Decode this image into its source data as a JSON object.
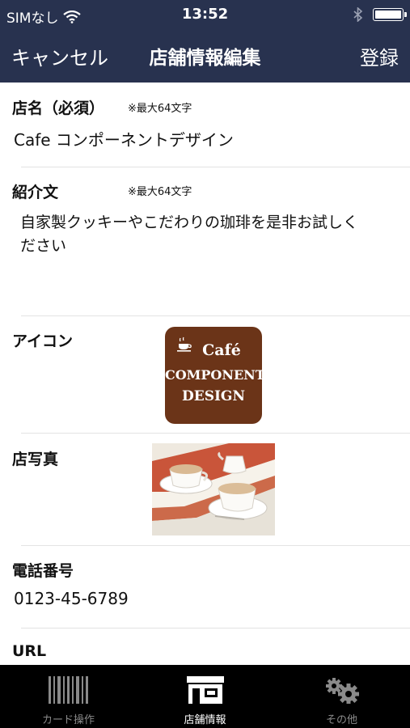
{
  "status_bar": {
    "carrier": "SIMなし",
    "time": "13:52"
  },
  "nav": {
    "cancel": "キャンセル",
    "title_part1": "店舗情報",
    "title_part2": "編集",
    "register": "登録"
  },
  "form": {
    "store_name": {
      "label": "店名（必須）",
      "note": "※最大64文字",
      "value": "Cafe コンポーネントデザイン"
    },
    "intro": {
      "label": "紹介文",
      "note": "※最大64文字",
      "value_line1": "自家製クッキーやこだわりの珈琲を是非お試しく",
      "value_line2": "ださい"
    },
    "icon": {
      "label": "アイコン",
      "logo_line1": "Café",
      "logo_line2": "COMPONENT",
      "logo_line3": "DESIGN",
      "logo_color": "#6b3418"
    },
    "photo": {
      "label": "店写真"
    },
    "phone": {
      "label": "電話番号",
      "value": "0123-45-6789"
    },
    "url": {
      "label": "URL"
    }
  },
  "tab_bar": {
    "tabs": [
      {
        "label": "カード操作",
        "icon": "barcode-icon",
        "active": false
      },
      {
        "label": "店舗情報",
        "icon": "storefront-icon",
        "active": true
      },
      {
        "label": "その他",
        "icon": "gears-icon",
        "active": false
      }
    ]
  },
  "colors": {
    "nav_background": "#28324f",
    "tab_background": "#000000",
    "tab_inactive": "#8a8a8a",
    "divider": "#e3e3e3"
  }
}
